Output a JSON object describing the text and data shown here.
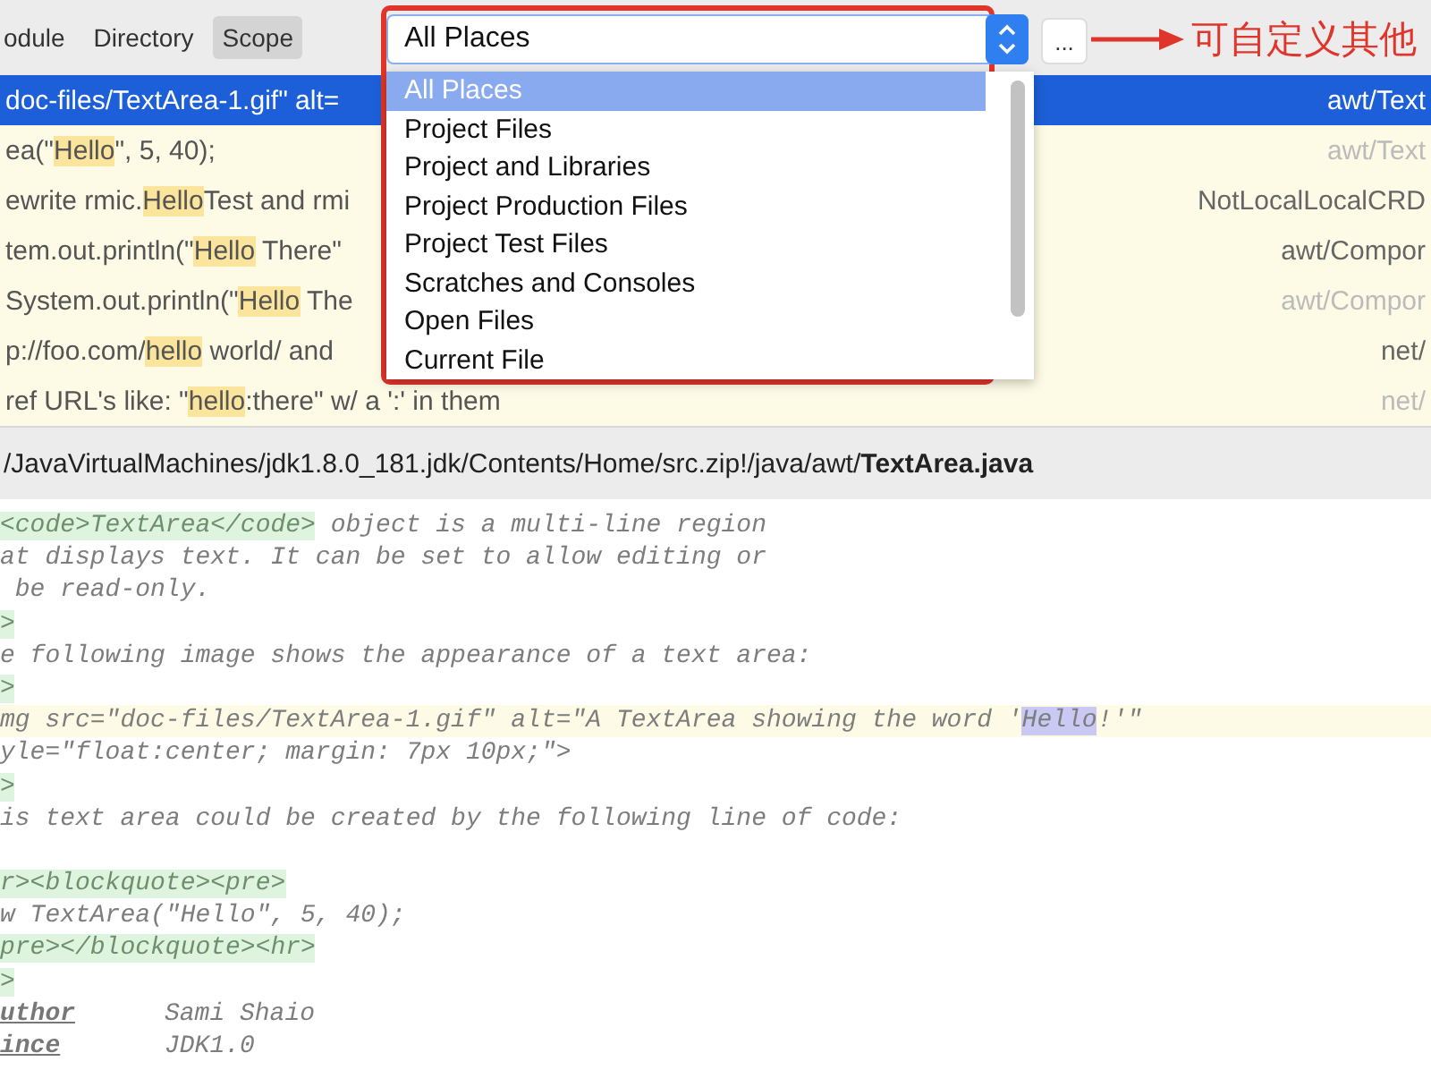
{
  "toolbar": {
    "tabs": [
      {
        "label": "odule",
        "selected": false
      },
      {
        "label": "Directory",
        "selected": false
      },
      {
        "label": "Scope",
        "selected": true
      }
    ]
  },
  "scope": {
    "value": "All Places",
    "more_button": "...",
    "annotation": "可自定义其他",
    "options": [
      {
        "label": "All Places",
        "selected": true
      },
      {
        "label": "Project Files",
        "selected": false
      },
      {
        "label": "Project and Libraries",
        "selected": false
      },
      {
        "label": "Project Production Files",
        "selected": false
      },
      {
        "label": "Project Test Files",
        "selected": false
      },
      {
        "label": "Scratches and Consoles",
        "selected": false
      },
      {
        "label": "Open Files",
        "selected": false
      },
      {
        "label": "Current File",
        "selected": false
      }
    ]
  },
  "results": [
    {
      "selected": true,
      "dimmed": false,
      "path": "awt/Text",
      "segments": [
        {
          "kind": "plain",
          "text": "doc-files/TextArea-1.gif\" alt="
        }
      ]
    },
    {
      "selected": false,
      "dimmed": true,
      "path": "awt/Text",
      "segments": [
        {
          "kind": "plain",
          "text": "ea(\""
        },
        {
          "kind": "match",
          "text": "Hello"
        },
        {
          "kind": "plain",
          "text": "\", 5, 40);"
        }
      ]
    },
    {
      "selected": false,
      "dimmed": false,
      "path": "NotLocalLocalCRD",
      "segments": [
        {
          "kind": "plain",
          "text": "ewrite rmic."
        },
        {
          "kind": "match",
          "text": "Hello"
        },
        {
          "kind": "plain",
          "text": "Test and rmi"
        }
      ]
    },
    {
      "selected": false,
      "dimmed": false,
      "path": "awt/Compor",
      "segments": [
        {
          "kind": "plain",
          "text": "tem.out.println(\""
        },
        {
          "kind": "match",
          "text": "Hello"
        },
        {
          "kind": "plain",
          "text": " There\""
        }
      ]
    },
    {
      "selected": false,
      "dimmed": true,
      "path": "awt/Compor",
      "segments": [
        {
          "kind": "plain",
          "text": "System.out.println(\""
        },
        {
          "kind": "match",
          "text": "Hello"
        },
        {
          "kind": "plain",
          "text": " The"
        }
      ]
    },
    {
      "selected": false,
      "dimmed": false,
      "path": "net/",
      "segments": [
        {
          "kind": "plain",
          "text": "p://foo.com/"
        },
        {
          "kind": "match",
          "text": "hello"
        },
        {
          "kind": "plain",
          "text": " world/ and"
        }
      ]
    },
    {
      "selected": false,
      "dimmed": true,
      "path": "net/",
      "segments": [
        {
          "kind": "plain",
          "text": "ref URL's like: \""
        },
        {
          "kind": "match",
          "text": "hello"
        },
        {
          "kind": "plain",
          "text": ":there\" w/ a ':' in them"
        }
      ]
    }
  ],
  "file_path": "/JavaVirtualMachines/jdk1.8.0_181.jdk/Contents/Home/src.zip!/java/awt/**TextArea.java**",
  "code_lines": [
    {
      "kind": "code",
      "current": false,
      "segments": [
        {
          "kind": "tag",
          "text": "<code>TextArea</code>"
        },
        {
          "kind": "text",
          "text": " object is a multi-line region"
        }
      ]
    },
    {
      "kind": "code",
      "current": false,
      "segments": [
        {
          "kind": "text",
          "text": "at displays text. It can be set to allow editing or"
        }
      ]
    },
    {
      "kind": "code",
      "current": false,
      "segments": [
        {
          "kind": "text",
          "text": " be read-only."
        }
      ]
    },
    {
      "kind": "code",
      "current": false,
      "segments": [
        {
          "kind": "tag",
          "text": ">"
        }
      ]
    },
    {
      "kind": "code",
      "current": false,
      "segments": [
        {
          "kind": "text",
          "text": "e following image shows the appearance of a text area:"
        }
      ]
    },
    {
      "kind": "code",
      "current": false,
      "segments": [
        {
          "kind": "tag",
          "text": ">"
        }
      ]
    },
    {
      "kind": "code",
      "current": true,
      "segments": [
        {
          "kind": "text",
          "text": "mg src=\"doc-files/TextArea-1.gif\" alt=\"A TextArea showing the word '"
        },
        {
          "kind": "match",
          "text": "Hello"
        },
        {
          "kind": "text",
          "text": "!'\""
        }
      ]
    },
    {
      "kind": "code",
      "current": false,
      "segments": [
        {
          "kind": "text",
          "text": "yle=\"float:center; margin: 7px 10px;\">"
        }
      ]
    },
    {
      "kind": "code",
      "current": false,
      "segments": [
        {
          "kind": "tag",
          "text": ">"
        }
      ]
    },
    {
      "kind": "code",
      "current": false,
      "segments": [
        {
          "kind": "text",
          "text": "is text area could be created by the following line of code:"
        }
      ]
    },
    {
      "kind": "blank",
      "current": false
    },
    {
      "kind": "code",
      "current": false,
      "segments": [
        {
          "kind": "tag",
          "text": "r><blockquote><pre>"
        }
      ]
    },
    {
      "kind": "code",
      "current": false,
      "segments": [
        {
          "kind": "text",
          "text": "w TextArea(\"Hello\", 5, 40);"
        }
      ]
    },
    {
      "kind": "code",
      "current": false,
      "segments": [
        {
          "kind": "tag",
          "text": "pre></blockquote><hr>"
        }
      ]
    },
    {
      "kind": "code",
      "current": false,
      "segments": [
        {
          "kind": "tag",
          "text": ">"
        }
      ]
    },
    {
      "kind": "code",
      "current": false,
      "segments": [
        {
          "kind": "doctag",
          "text": "uthor"
        },
        {
          "kind": "value",
          "text": "Sami Shaio"
        }
      ]
    },
    {
      "kind": "code",
      "current": false,
      "segments": [
        {
          "kind": "doctag",
          "text": "ince"
        },
        {
          "kind": "value",
          "text": "JDK1.0"
        }
      ]
    }
  ]
}
